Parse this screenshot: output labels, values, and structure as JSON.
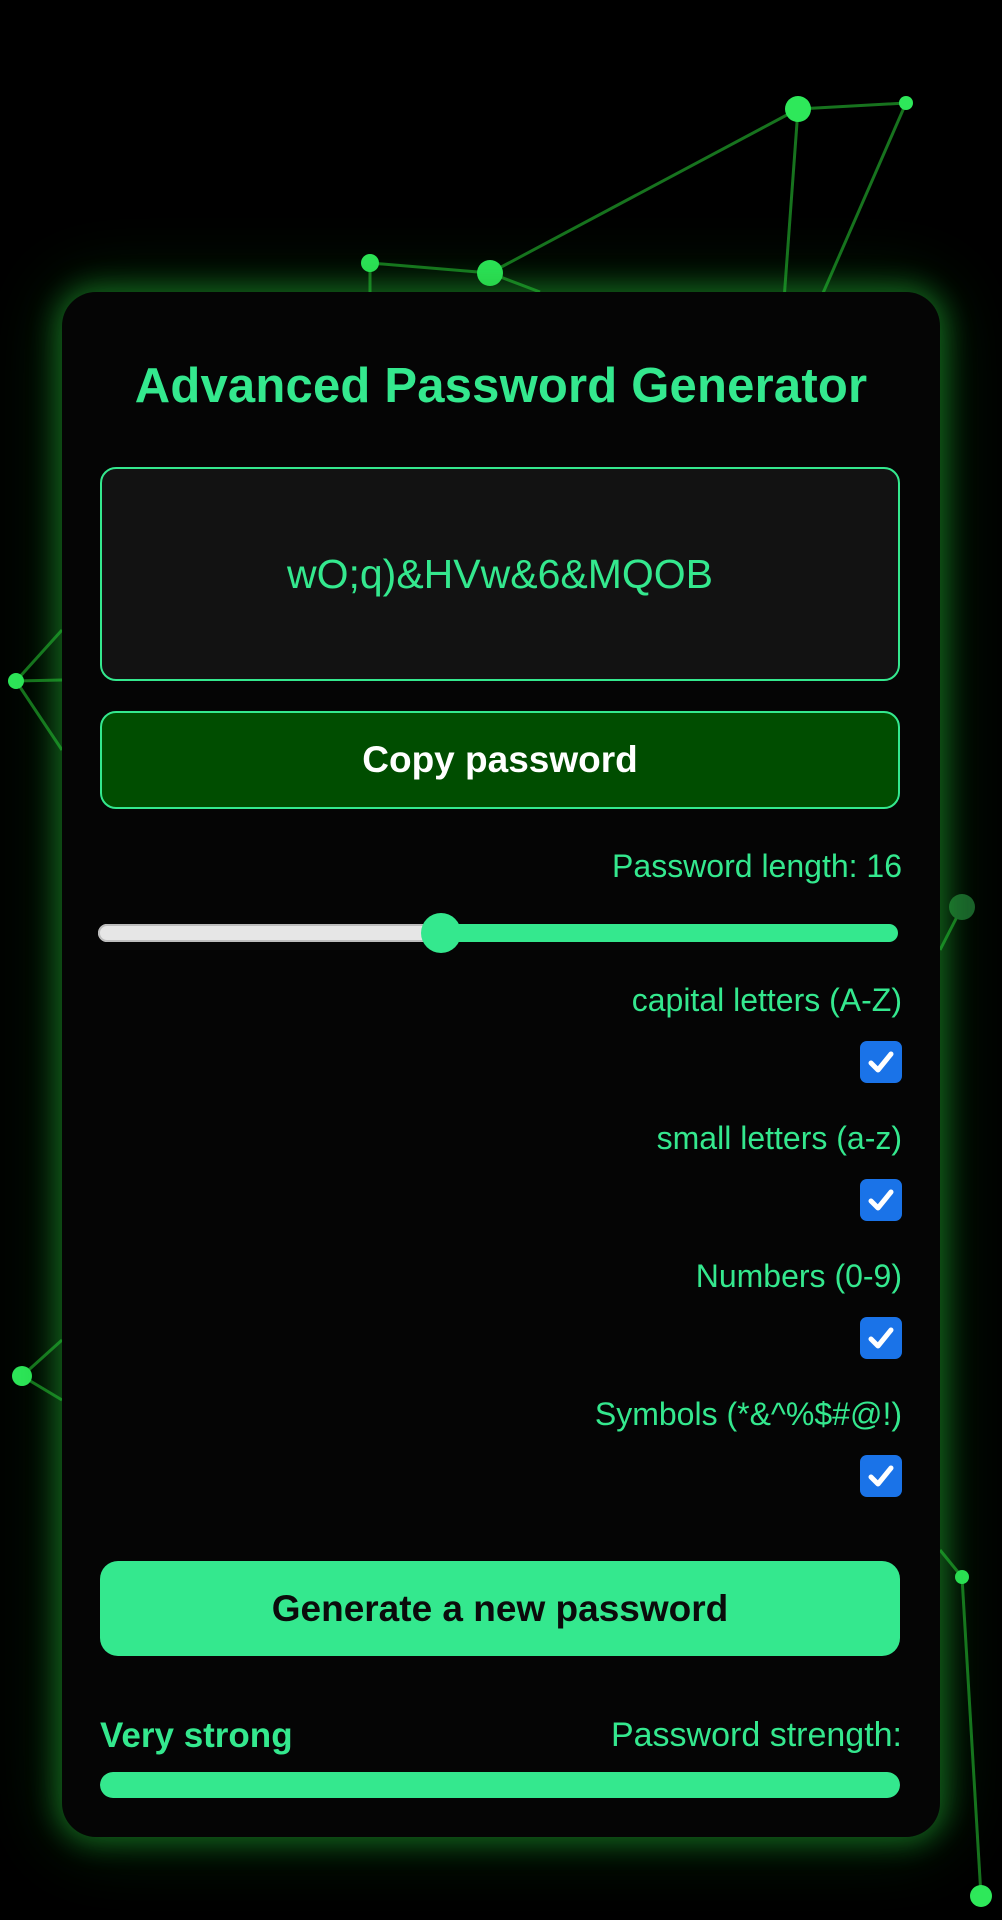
{
  "app": {
    "title": "Advanced Password Generator"
  },
  "password": {
    "value": "wO;q)&HVw&6&MQOB"
  },
  "copy_button": {
    "label": "Copy password"
  },
  "length": {
    "label": "Password length: 16",
    "value": 16,
    "min": 4,
    "max": 32
  },
  "options": [
    {
      "label": "capital letters (A-Z)",
      "checked": true
    },
    {
      "label": "small letters (a-z)",
      "checked": true
    },
    {
      "label": "Numbers (0-9)",
      "checked": true
    },
    {
      "label": "Symbols (*&^%$#@!)",
      "checked": true
    }
  ],
  "generate_button": {
    "label": "Generate a new password"
  },
  "strength": {
    "value_label": "Very strong",
    "label": "Password strength:",
    "level": 1.0
  },
  "colors": {
    "accent": "#34e88e",
    "copy_button_bg": "#004d00",
    "checkbox": "#1a73e8",
    "background": "#000000"
  },
  "icons": {
    "checkbox": "checkmark-icon"
  }
}
